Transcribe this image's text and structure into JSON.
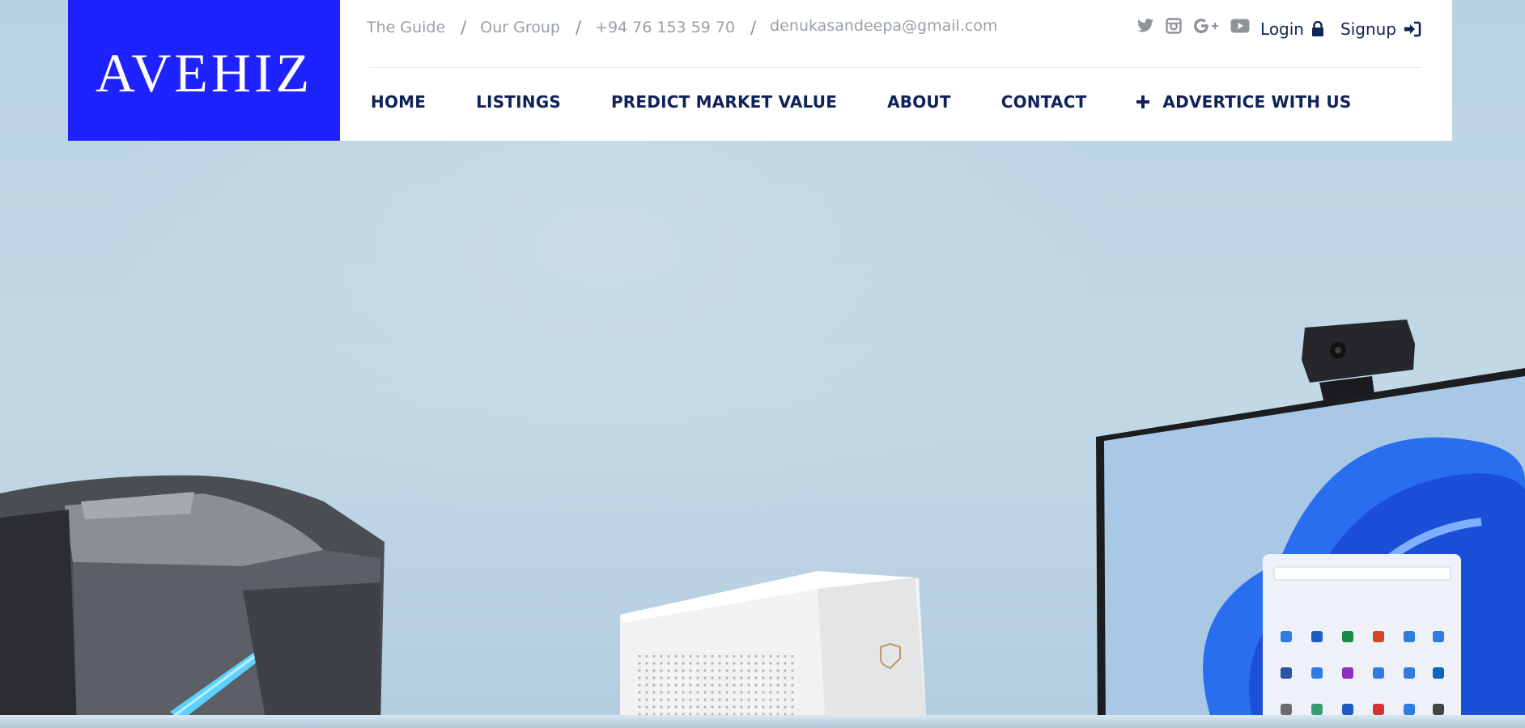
{
  "brand": {
    "logo": "AVEHIZ",
    "logo_bg": "#1e22ff"
  },
  "topbar": {
    "links": [
      "The Guide",
      "Our Group",
      "+94 76 153 59 70"
    ],
    "separator": "/",
    "email": "denukasandeepa@gmail.com"
  },
  "social": {
    "icons": [
      "twitter-icon",
      "instagram-icon",
      "google-plus-icon",
      "youtube-icon"
    ]
  },
  "account": {
    "login": "Login",
    "login_icon": "lock-icon",
    "signup": "Signup",
    "signup_icon": "sign-in-icon"
  },
  "nav": {
    "items": [
      "HOME",
      "LISTINGS",
      "PREDICT MARKET VALUE",
      "ABOUT",
      "CONTACT"
    ],
    "advertise": "ADVERTICE WITH US",
    "advertise_icon": "plus-icon"
  },
  "hero": {
    "products": [
      "gaming-pc-tower",
      "mini-pc",
      "monitor-with-webcam"
    ]
  },
  "colors": {
    "nav_text": "#0f2259",
    "topbar_text": "#9aa0a6",
    "hero_bg": "#bcd5e4"
  }
}
